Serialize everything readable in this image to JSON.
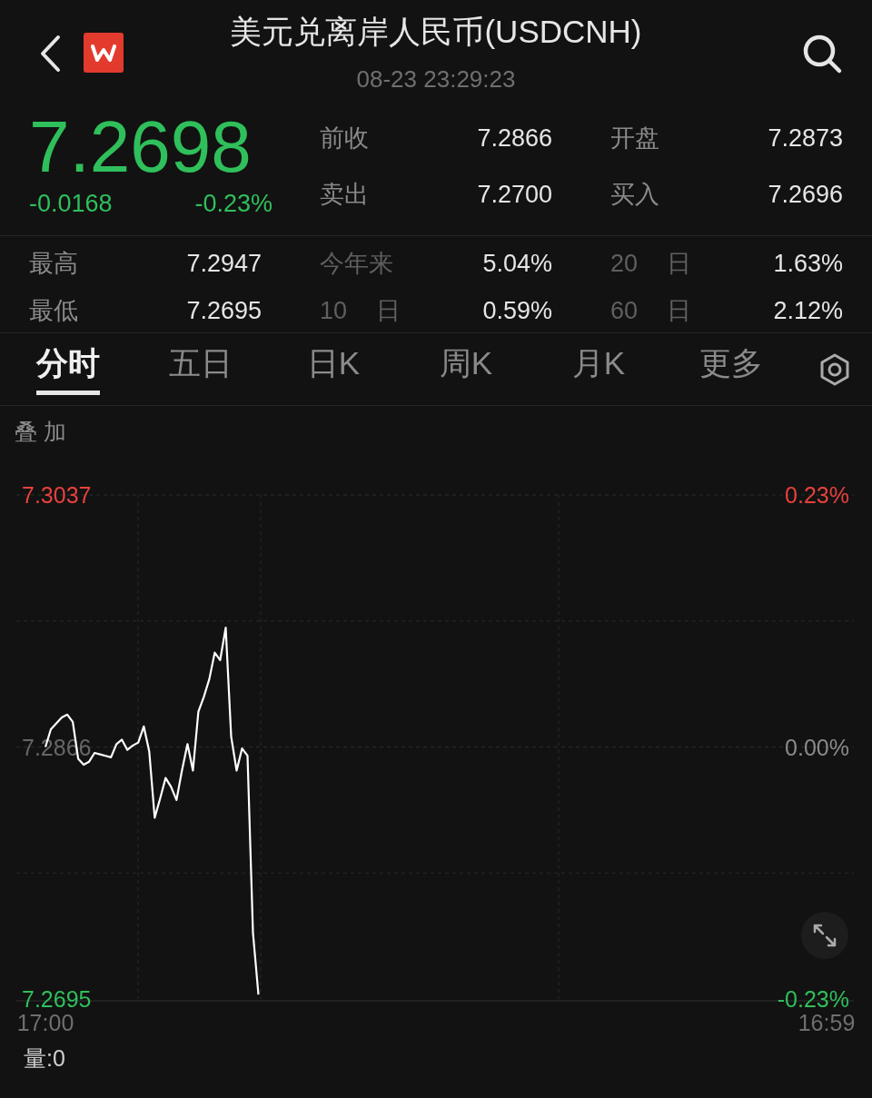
{
  "header": {
    "title": "美元兑离岸人民币(USDCNH)",
    "time": "08-23 23:29:23"
  },
  "quote": {
    "price": "7.2698",
    "change": "-0.0168",
    "change_pct": "-0.23%",
    "falling": true
  },
  "quote_stats": [
    {
      "label": "前收",
      "value": "7.2866"
    },
    {
      "label": "开盘",
      "value": "7.2873"
    },
    {
      "label": "卖出",
      "value": "7.2700"
    },
    {
      "label": "买入",
      "value": "7.2696"
    }
  ],
  "range_stats": [
    {
      "label": "最高",
      "value": "7.2947"
    },
    {
      "label": "今年来",
      "value": "5.04%"
    },
    {
      "label": "20 日",
      "value": "1.63%"
    },
    {
      "label": "最低",
      "value": "7.2695"
    },
    {
      "label": "10 日",
      "value": "0.59%"
    },
    {
      "label": "60 日",
      "value": "2.12%"
    }
  ],
  "tabs": [
    {
      "label": "分时",
      "selected": true
    },
    {
      "label": "五日",
      "selected": false
    },
    {
      "label": "日K",
      "selected": false
    },
    {
      "label": "周K",
      "selected": false
    },
    {
      "label": "月K",
      "selected": false
    },
    {
      "label": "更多",
      "selected": false
    }
  ],
  "overlay_label": "叠 加",
  "chart": {
    "change_labels": [
      {
        "text": "0.23%",
        "color": "#e8413c"
      },
      {
        "text": "0.00%",
        "color": "#8a8a8a"
      },
      {
        "text": "-0.23%",
        "color": "#2fbf5b"
      }
    ],
    "chart_data": {
      "type": "line",
      "categories": [
        "17:00",
        null,
        null,
        null,
        null,
        null,
        null,
        null,
        null,
        null,
        null,
        null,
        null,
        null,
        null,
        null,
        null,
        null,
        null,
        null,
        null,
        null,
        null,
        null,
        null,
        null,
        null,
        null,
        null,
        null,
        null,
        null,
        null,
        null,
        null,
        null,
        null,
        null,
        null,
        null,
        null,
        null,
        null,
        null,
        null,
        null,
        null,
        null,
        null,
        null,
        null,
        null,
        null,
        null,
        null,
        null,
        null,
        null,
        null,
        null,
        null,
        null,
        null,
        null,
        null,
        null,
        null,
        null,
        null,
        null,
        null,
        null,
        null,
        null,
        null,
        null,
        null,
        null,
        null,
        null,
        null,
        null,
        null,
        null,
        null,
        null,
        null,
        null,
        null,
        null,
        null,
        null,
        null,
        null,
        null,
        null,
        null,
        null,
        null,
        null,
        null,
        null,
        null,
        null,
        null,
        null,
        null,
        null,
        null,
        null,
        null,
        null,
        null,
        null,
        null,
        null,
        null,
        null,
        null,
        null,
        null,
        null,
        null,
        null,
        null,
        null,
        null,
        null,
        null,
        null,
        null,
        null,
        null,
        null,
        null,
        null,
        null,
        null,
        null,
        null,
        null,
        null,
        null,
        "16:59"
      ],
      "series": [
        {
          "color": "#ffffff",
          "values": [
            7.2866,
            7.2878,
            7.2882,
            7.2886,
            7.2888,
            7.2883,
            7.2858,
            7.2854,
            7.2856,
            7.2862,
            7.2861,
            7.286,
            7.2859,
            7.2868,
            7.2871,
            7.2864,
            7.2867,
            7.2869,
            7.288,
            7.2863,
            7.2818,
            7.2831,
            7.2845,
            7.2839,
            7.283,
            7.285,
            7.2868,
            7.285,
            7.289,
            7.29,
            7.2912,
            7.293,
            7.2925,
            7.2947,
            7.2873,
            7.285,
            7.2865,
            7.286,
            7.274,
            7.2698,
            null,
            null,
            null,
            null,
            null,
            null,
            null,
            null,
            null,
            null,
            null,
            null,
            null,
            null,
            null,
            null,
            null,
            null,
            null,
            null,
            null,
            null,
            null,
            null,
            null,
            null,
            null,
            null,
            null,
            null,
            null,
            null,
            null,
            null,
            null,
            null,
            null,
            null,
            null,
            null,
            null,
            null,
            null,
            null,
            null,
            null,
            null,
            null,
            null,
            null,
            null,
            null,
            null,
            null,
            null,
            null,
            null,
            null,
            null,
            null,
            null,
            null,
            null,
            null,
            null,
            null,
            null,
            null,
            null,
            null,
            null,
            null,
            null,
            null,
            null,
            null,
            null,
            null,
            null,
            null,
            null,
            null,
            null,
            null,
            null,
            null,
            null,
            null,
            null,
            null,
            null,
            null,
            null,
            null,
            null,
            null,
            null,
            null,
            null,
            null,
            null,
            null,
            null,
            null
          ]
        }
      ],
      "ylim": [
        7.2695,
        7.3037
      ],
      "yticks": [
        {
          "value": 7.3037,
          "label": "7.3037"
        },
        {
          "value": 7.2866,
          "label": "7.2866"
        },
        {
          "value": 7.2695,
          "label": "7.2695"
        }
      ]
    }
  },
  "volume": {
    "label": "量:0"
  }
}
